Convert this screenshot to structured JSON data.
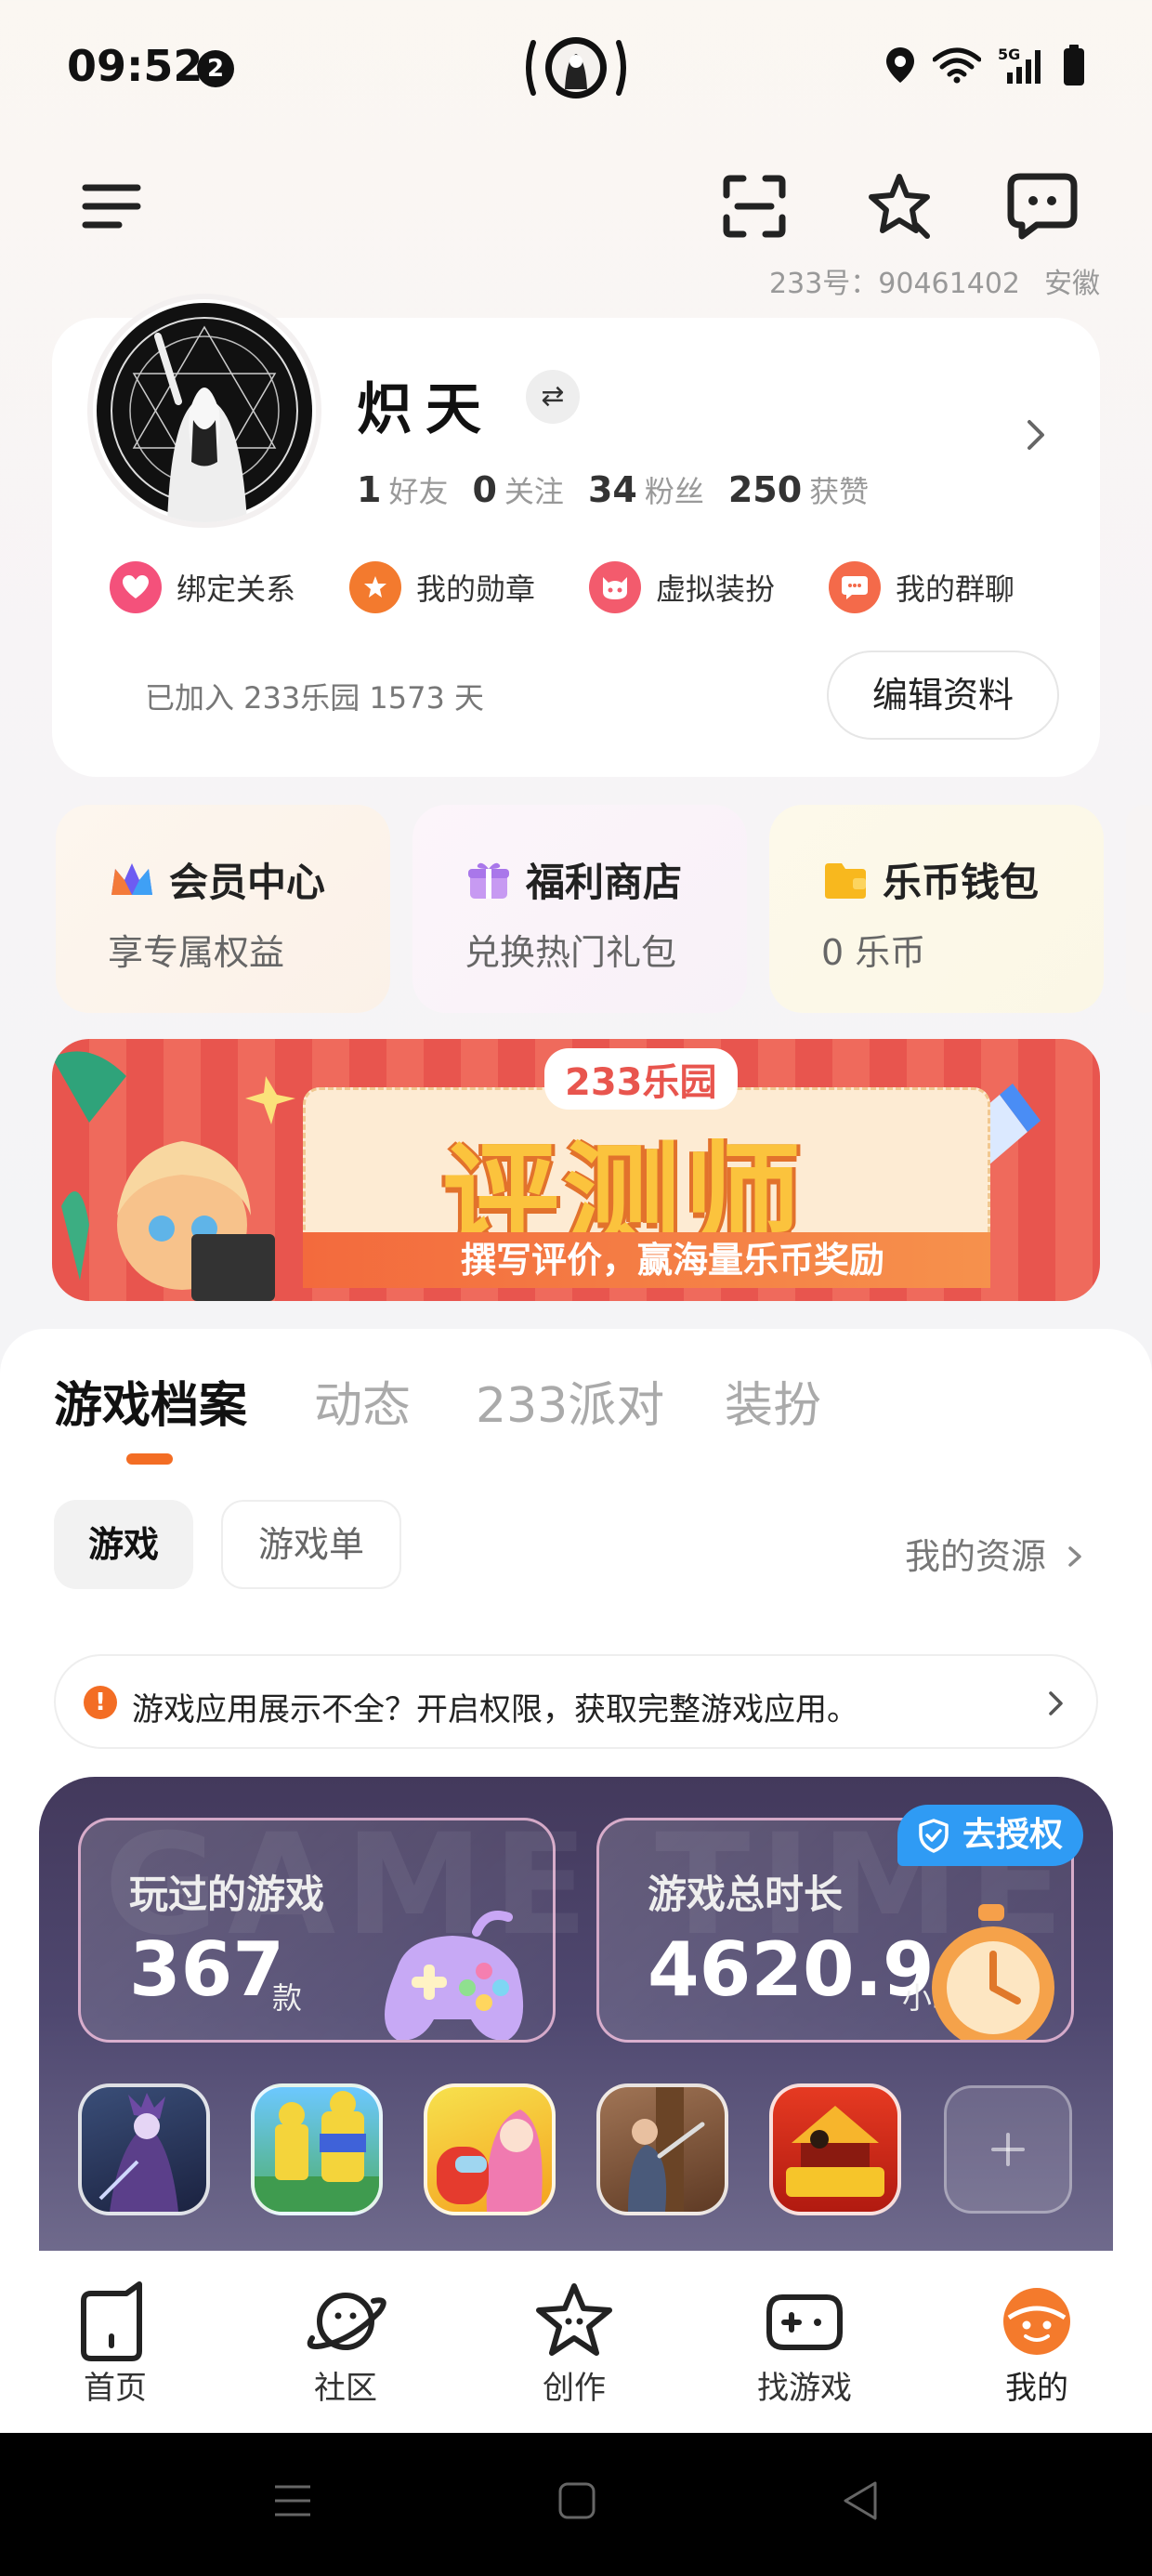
{
  "status_bar": {
    "time": "09:52",
    "notification_count": "2",
    "network": "5G"
  },
  "header": {
    "account_id_label": "233号：90461402",
    "location": "安徽"
  },
  "profile": {
    "username": "炽天",
    "stats": [
      {
        "num": "1",
        "label": "好友"
      },
      {
        "num": "0",
        "label": "关注"
      },
      {
        "num": "34",
        "label": "粉丝"
      },
      {
        "num": "250",
        "label": "获赞"
      }
    ],
    "quick_links": [
      {
        "label": "绑定关系",
        "color": "#f4517b"
      },
      {
        "label": "我的勋章",
        "color": "#f37a2e"
      },
      {
        "label": "虚拟装扮",
        "color": "#f35b6d"
      },
      {
        "label": "我的群聊",
        "color": "#f46a4a"
      }
    ],
    "joined_text": "已加入 233乐园 1573 天",
    "edit_label": "编辑资料"
  },
  "features": [
    {
      "title": "会员中心",
      "subtitle": "享专属权益"
    },
    {
      "title": "福利商店",
      "subtitle": "兑换热门礼包"
    },
    {
      "title": "乐币钱包",
      "subtitle": "0 乐币"
    }
  ],
  "banner": {
    "brand": "233乐园",
    "title": "评测师",
    "tagline": "撰写评价，赢海量乐币奖励"
  },
  "tabs": [
    "游戏档案",
    "动态",
    "233派对",
    "装扮"
  ],
  "chips": [
    "游戏",
    "游戏单"
  ],
  "my_resources": "我的资源",
  "notice": "游戏应用展示不全？开启权限，获取完整游戏应用。",
  "game_stats": {
    "watermark": "GAME TIME",
    "authorize_label": "去授权",
    "played": {
      "title": "玩过的游戏",
      "value": "367",
      "unit": "款"
    },
    "playtime": {
      "title": "游戏总时长",
      "value": "4620.9",
      "unit": "小时"
    }
  },
  "bottom_nav": [
    {
      "label": "首页"
    },
    {
      "label": "社区"
    },
    {
      "label": "创作"
    },
    {
      "label": "找游戏"
    },
    {
      "label": "我的"
    }
  ],
  "colors": {
    "accent": "#f36d24",
    "authorize_blue": "#2f9bf4",
    "panel_bg": "#4f4870"
  }
}
